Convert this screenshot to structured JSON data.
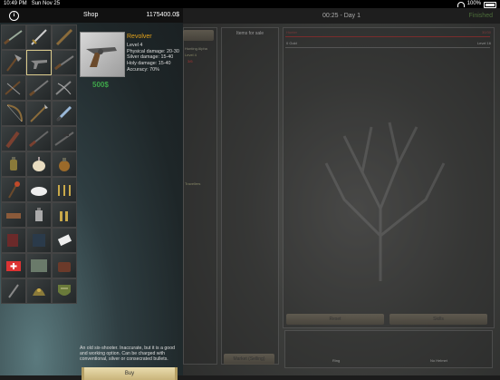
{
  "status_bar": {
    "time": "10:49 PM",
    "date": "Sun Nov 25",
    "battery": "100%"
  },
  "game": {
    "clock": "00:25 - Day 1",
    "done_label": "Finished",
    "left_panel_label": "Hunting Alpha",
    "left_panel_sub": "Level 4",
    "left_panel_hp": "3/6",
    "left_panel_extra": "Travellers",
    "middle_panel_title": "Items for sale",
    "hunter_name": "Hunter",
    "hunter_hp": "30/30",
    "hunter_gold": "0 Gold",
    "hunter_level": "Level 16",
    "reset_label": "Reset",
    "skills_label": "Skills",
    "market_label": "Market (Selling)",
    "slot1_label": "Ring",
    "slot2_label": "No Helmet"
  },
  "shop": {
    "title": "Shop",
    "money": "1175400.0$",
    "items": [
      "shotgun-icon",
      "sword-icon",
      "stake-icon",
      "axe-icon",
      "revolver-icon",
      "rifle-icon",
      "crossbow-icon",
      "bayonet-rifle-icon",
      "double-crossbow-icon",
      "bow-icon",
      "spear-icon",
      "dagger-icon",
      "club-icon",
      "musket-icon",
      "sniper-rifle-icon",
      "holy-water-icon",
      "garlic-icon",
      "grenade-icon",
      "torch-icon",
      "salt-icon",
      "bullets-icon",
      "dynamite-icon",
      "lantern-icon",
      "shells-icon",
      "book-icon",
      "book-dark-icon",
      "note-icon",
      "medkit-icon",
      "map-icon",
      "bag-icon",
      "knife-icon",
      "helmet-icon",
      "shield-icon"
    ],
    "selected": {
      "name": "Revolver",
      "level": "Level 4",
      "physical": "Physical damage: 20-30",
      "silver": "Silver damage: 15-40",
      "holy": "Holy damage: 15-40",
      "accuracy": "Accuracy: 70%",
      "price": "500$",
      "description": "An old six-shooter. Inaccurate, but it is a good and working option. Can be charged with conventional, silver or consecrated bullets."
    },
    "buy_label": "Buy"
  },
  "colors": {
    "item_name": "#e4a31b",
    "price": "#3fa64a",
    "buy_button": "#e0d19e"
  }
}
